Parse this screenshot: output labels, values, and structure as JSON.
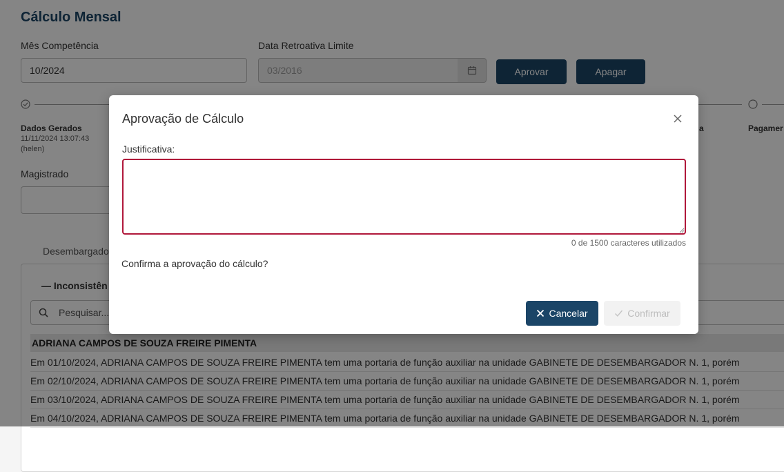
{
  "page": {
    "title": "Cálculo Mensal",
    "mes_competencia": {
      "label": "Mês Competência",
      "value": "10/2024"
    },
    "data_retroativa": {
      "label": "Data Retroativa Limite",
      "value": "03/2016"
    },
    "buttons": {
      "aprovar": "Aprovar",
      "apagar": "Apagar"
    },
    "steps": [
      {
        "title": "Dados Gerados",
        "datetime": "11/11/2024 13:07:43",
        "user": "(helen)",
        "status": "done"
      },
      {
        "title": "a",
        "status": "pending"
      },
      {
        "title": "Pagamer",
        "status": "pending"
      }
    ],
    "magistrado_label": "Magistrado",
    "tab_label": "Desembargador",
    "section_title": "Inconsistên",
    "search_placeholder": "Pesquisar...",
    "group_name": "ADRIANA CAMPOS DE SOUZA FREIRE PIMENTA",
    "rows": [
      "Em 01/10/2024, ADRIANA CAMPOS DE SOUZA FREIRE PIMENTA tem uma portaria de função auxiliar na unidade GABINETE DE DESEMBARGADOR N. 1, porém",
      "Em 02/10/2024, ADRIANA CAMPOS DE SOUZA FREIRE PIMENTA tem uma portaria de função auxiliar na unidade GABINETE DE DESEMBARGADOR N. 1, porém",
      "Em 03/10/2024, ADRIANA CAMPOS DE SOUZA FREIRE PIMENTA tem uma portaria de função auxiliar na unidade GABINETE DE DESEMBARGADOR N. 1, porém",
      "Em 04/10/2024, ADRIANA CAMPOS DE SOUZA FREIRE PIMENTA tem uma portaria de função auxiliar na unidade GABINETE DE DESEMBARGADOR N. 1, porém"
    ]
  },
  "modal": {
    "title": "Aprovação de Cálculo",
    "justificativa_label": "Justificativa:",
    "justificativa_value": "",
    "counter": "0 de 1500 caracteres utilizados",
    "question": "Confirma a aprovação do cálculo?",
    "cancel_label": "Cancelar",
    "confirm_label": "Confirmar"
  },
  "icons": {
    "close": "close-icon",
    "calendar": "calendar-icon",
    "search": "search-icon",
    "cancel": "x-icon",
    "confirm": "check-icon"
  },
  "colors": {
    "primary": "#1b4567",
    "textarea_border": "#b0173a",
    "overlay": "rgba(0,0,0,0.48)"
  }
}
